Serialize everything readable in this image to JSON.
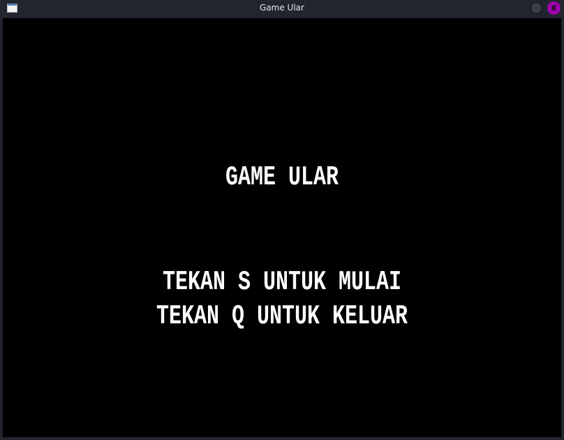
{
  "window": {
    "title": "Game Ular",
    "close_icon": "x"
  },
  "game": {
    "title": "GAME ULAR",
    "start_hint": "TEKAN S UNTUK MULAI",
    "quit_hint": "TEKAN Q UNTUK KELUAR"
  }
}
